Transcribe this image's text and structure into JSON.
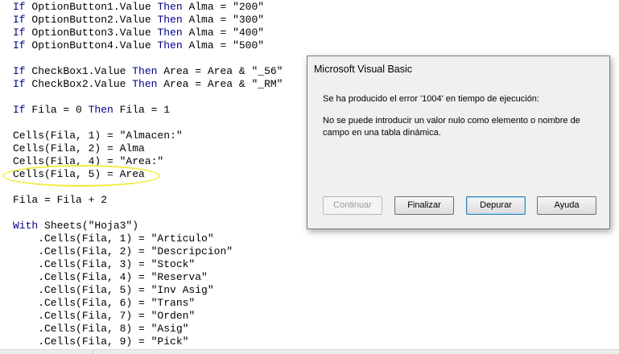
{
  "code_lines": [
    {
      "parts": [
        {
          "t": "If",
          "k": true
        },
        {
          "t": " OptionButton1.Value "
        },
        {
          "t": "Then",
          "k": true
        },
        {
          "t": " Alma = \"200\""
        }
      ]
    },
    {
      "parts": [
        {
          "t": "If",
          "k": true
        },
        {
          "t": " OptionButton2.Value "
        },
        {
          "t": "Then",
          "k": true
        },
        {
          "t": " Alma = \"300\""
        }
      ]
    },
    {
      "parts": [
        {
          "t": "If",
          "k": true
        },
        {
          "t": " OptionButton3.Value "
        },
        {
          "t": "Then",
          "k": true
        },
        {
          "t": " Alma = \"400\""
        }
      ]
    },
    {
      "parts": [
        {
          "t": "If",
          "k": true
        },
        {
          "t": " OptionButton4.Value "
        },
        {
          "t": "Then",
          "k": true
        },
        {
          "t": " Alma = \"500\""
        }
      ]
    },
    {
      "parts": []
    },
    {
      "parts": [
        {
          "t": "If",
          "k": true
        },
        {
          "t": " CheckBox1.Value "
        },
        {
          "t": "Then",
          "k": true
        },
        {
          "t": " Area = Area & \"_56\""
        }
      ]
    },
    {
      "parts": [
        {
          "t": "If",
          "k": true
        },
        {
          "t": " CheckBox2.Value "
        },
        {
          "t": "Then",
          "k": true
        },
        {
          "t": " Area = Area & \"_RM\""
        }
      ]
    },
    {
      "parts": []
    },
    {
      "parts": [
        {
          "t": "If",
          "k": true
        },
        {
          "t": " Fila = 0 "
        },
        {
          "t": "Then",
          "k": true
        },
        {
          "t": " Fila = 1"
        }
      ]
    },
    {
      "parts": []
    },
    {
      "parts": [
        {
          "t": "Cells(Fila, 1) = \"Almacen:\""
        }
      ]
    },
    {
      "parts": [
        {
          "t": "Cells(Fila, 2) = Alma"
        }
      ]
    },
    {
      "parts": [
        {
          "t": "Cells(Fila, 4) = \"Area:\""
        }
      ]
    },
    {
      "parts": [
        {
          "t": "Cells(Fila, 5) = Area"
        }
      ]
    },
    {
      "parts": []
    },
    {
      "parts": [
        {
          "t": "Fila = Fila + 2"
        }
      ]
    },
    {
      "parts": []
    },
    {
      "parts": [
        {
          "t": "With",
          "k": true
        },
        {
          "t": " Sheets(\"Hoja3\")"
        }
      ]
    },
    {
      "parts": [
        {
          "t": "    .Cells(Fila, 1) = \"Articulo\""
        }
      ]
    },
    {
      "parts": [
        {
          "t": "    .Cells(Fila, 2) = \"Descripcion\""
        }
      ]
    },
    {
      "parts": [
        {
          "t": "    .Cells(Fila, 3) = \"Stock\""
        }
      ]
    },
    {
      "parts": [
        {
          "t": "    .Cells(Fila, 4) = \"Reserva\""
        }
      ]
    },
    {
      "parts": [
        {
          "t": "    .Cells(Fila, 5) = \"Inv Asig\""
        }
      ]
    },
    {
      "parts": [
        {
          "t": "    .Cells(Fila, 6) = \"Trans\""
        }
      ]
    },
    {
      "parts": [
        {
          "t": "    .Cells(Fila, 7) = \"Orden\""
        }
      ]
    },
    {
      "parts": [
        {
          "t": "    .Cells(Fila, 8) = \"Asig\""
        }
      ]
    },
    {
      "parts": [
        {
          "t": "    .Cells(Fila, 9) = \"Pick\""
        }
      ]
    }
  ],
  "colors": {
    "keyword": "#00008b",
    "highlight": "#f3ec3a"
  },
  "dialog": {
    "title": "Microsoft Visual Basic",
    "message1": "Se ha producido el error '1004' en tiempo de ejecución:",
    "message2": "No se puede introducir un valor nulo como elemento o nombre de campo en una tabla dinámica.",
    "buttons": {
      "continue": "Continuar",
      "end": "Finalizar",
      "debug": "Depurar",
      "help": "Ayuda"
    }
  }
}
